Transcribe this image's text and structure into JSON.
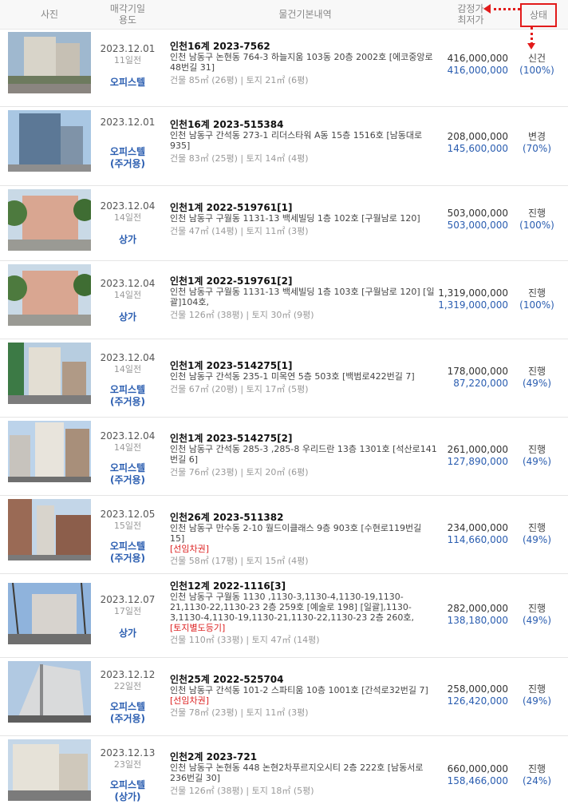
{
  "header": {
    "photo": "사진",
    "sale_date_1": "매각기일",
    "sale_date_2": "용도",
    "info": "물건기본내역",
    "appraisal_1": "감정가",
    "appraisal_2": "최저가",
    "status": "상태"
  },
  "rows": [
    {
      "date": "2023.12.01",
      "ago": "11일전",
      "use": "오피스텔",
      "use2": "",
      "case": "인천16계 2023-7562",
      "addr": "인천 남동구 논현동 764-3 하늘지움 103동 20층 2002호 [에코중앙로48번길 31]",
      "warn": "",
      "area": "건물 85㎡ (26평)  |  토지 21㎡ (6평)",
      "appraisal": "416,000,000",
      "min": "416,000,000",
      "status": "신건",
      "pct": "(100%)"
    },
    {
      "date": "2023.12.01",
      "ago": "",
      "use": "오피스텔",
      "use2": "(주거용)",
      "case": "인천16계 2023-515384",
      "addr": "인천 남동구 간석동 273-1 리더스타워 A동 15층 1516호 [남동대로935]",
      "warn": "",
      "area": "건물 83㎡ (25평)  |  토지 14㎡ (4평)",
      "appraisal": "208,000,000",
      "min": "145,600,000",
      "status": "변경",
      "pct": "(70%)"
    },
    {
      "date": "2023.12.04",
      "ago": "14일전",
      "use": "상가",
      "use2": "",
      "case": "인천1계 2022-519761[1]",
      "addr": "인천 남동구 구월동 1131-13 백세빌딩 1층 102호 [구월남로 120]",
      "warn": "",
      "area": "건물 47㎡ (14평)  |  토지 11㎡ (3평)",
      "appraisal": "503,000,000",
      "min": "503,000,000",
      "status": "진행",
      "pct": "(100%)"
    },
    {
      "date": "2023.12.04",
      "ago": "14일전",
      "use": "상가",
      "use2": "",
      "case": "인천1계 2022-519761[2]",
      "addr": "인천 남동구 구월동 1131-13 백세빌딩 1층 103호 [구월남로 120]  [일괄]104호,",
      "warn": "",
      "area": "건물 126㎡ (38평)  |  토지 30㎡ (9평)",
      "appraisal": "1,319,000,000",
      "min": "1,319,000,000",
      "status": "진행",
      "pct": "(100%)"
    },
    {
      "date": "2023.12.04",
      "ago": "14일전",
      "use": "오피스텔",
      "use2": "(주거용)",
      "case": "인천1계 2023-514275[1]",
      "addr": "인천 남동구 간석동 235-1 미목연 5층 503호 [백범로422번길 7]",
      "warn": "",
      "area": "건물 67㎡ (20평)  |  토지 17㎡ (5평)",
      "appraisal": "178,000,000",
      "min": "87,220,000",
      "status": "진행",
      "pct": "(49%)"
    },
    {
      "date": "2023.12.04",
      "ago": "14일전",
      "use": "오피스텔",
      "use2": "(주거용)",
      "case": "인천1계 2023-514275[2]",
      "addr": "인천 남동구 간석동 285-3 ,285-8 우리드란 13층 1301호 [석산로141번길 6]",
      "warn": "",
      "area": "건물 76㎡ (23평)  |  토지 20㎡ (6평)",
      "appraisal": "261,000,000",
      "min": "127,890,000",
      "status": "진행",
      "pct": "(49%)"
    },
    {
      "date": "2023.12.05",
      "ago": "15일전",
      "use": "오피스텔",
      "use2": "(주거용)",
      "case": "인천26계 2023-511382",
      "addr": "인천 남동구 만수동 2-10 월드이클래스 9층 903호 [수현로119번길 15]",
      "warn": "[선임차권]",
      "area": "건물 58㎡ (17평)  |  토지 15㎡ (4평)",
      "appraisal": "234,000,000",
      "min": "114,660,000",
      "status": "진행",
      "pct": "(49%)"
    },
    {
      "date": "2023.12.07",
      "ago": "17일전",
      "use": "상가",
      "use2": "",
      "case": "인천12계 2022-1116[3]",
      "addr": "인천 남동구 구월동 1130 ,1130-3,1130-4,1130-19,1130-21,1130-22,1130-23 2층 259호 [예술로 198]  [일괄],1130-3,1130-4,1130-19,1130-21,1130-22,1130-23 2층 260호,",
      "warn": "[토지별도등기]",
      "area": "건물 110㎡ (33평)  |  토지 47㎡ (14평)",
      "appraisal": "282,000,000",
      "min": "138,180,000",
      "status": "진행",
      "pct": "(49%)"
    },
    {
      "date": "2023.12.12",
      "ago": "22일전",
      "use": "오피스텔",
      "use2": "(주거용)",
      "case": "인천25계 2022-525704",
      "addr": "인천 남동구 간석동 101-2 스파티움 10층 1001호 [간석로32번길 7]",
      "warn": "[선임차권]",
      "area": "건물 78㎡ (23평)  |  토지 11㎡ (3평)",
      "appraisal": "258,000,000",
      "min": "126,420,000",
      "status": "진행",
      "pct": "(49%)"
    },
    {
      "date": "2023.12.13",
      "ago": "23일전",
      "use": "오피스텔",
      "use2": "(상가)",
      "case": "인천2계 2023-721",
      "addr": "인천 남동구 논현동 448 논현2차푸르지오시티 2층 222호 [남동서로236번길 30]",
      "warn": "",
      "area": "건물 126㎡ (38평)  |  토지 18㎡ (5평)",
      "appraisal": "660,000,000",
      "min": "158,466,000",
      "status": "진행",
      "pct": "(24%)"
    }
  ]
}
